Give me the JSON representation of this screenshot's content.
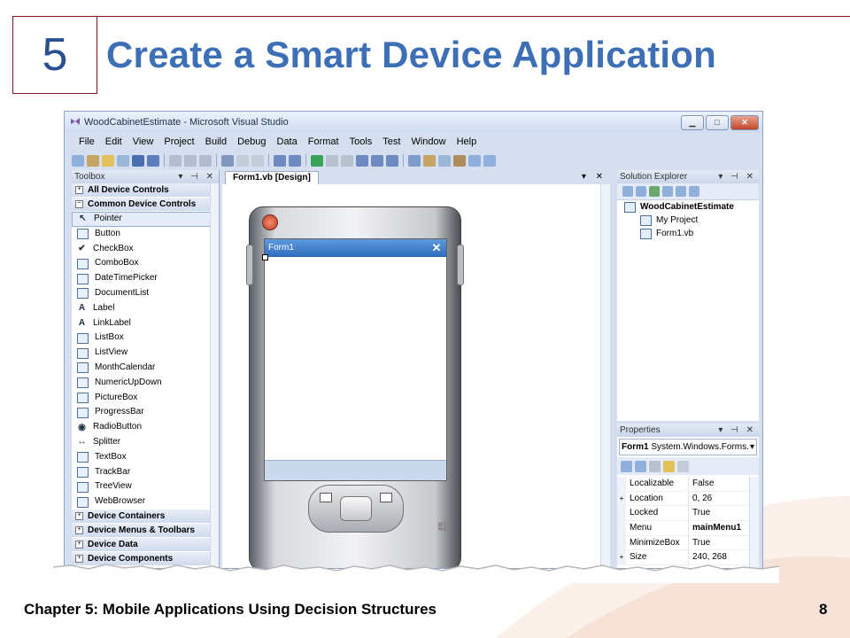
{
  "slide": {
    "chapter_number": "5",
    "title": "Create a Smart Device Application",
    "footer": "Chapter 5: Mobile Applications Using Decision Structures",
    "page_number": "8"
  },
  "colors": {
    "title": "#3d6fb6",
    "accent_line": "#7a1a1a",
    "form_titlebar": "#3f7fcf"
  },
  "window": {
    "title": "WoodCabinetEstimate - Microsoft Visual Studio",
    "menu": [
      "File",
      "Edit",
      "View",
      "Project",
      "Build",
      "Debug",
      "Data",
      "Format",
      "Tools",
      "Test",
      "Window",
      "Help"
    ]
  },
  "toolbox": {
    "title": "Toolbox",
    "category_all": "All Device Controls",
    "category_common": "Common Device Controls",
    "items": [
      {
        "label": "Pointer",
        "icon": "pointer-icon"
      },
      {
        "label": "Button",
        "icon": "button-icon"
      },
      {
        "label": "CheckBox",
        "icon": "checkbox-icon"
      },
      {
        "label": "ComboBox",
        "icon": "combobox-icon"
      },
      {
        "label": "DateTimePicker",
        "icon": "datetimepicker-icon"
      },
      {
        "label": "DocumentList",
        "icon": "documentlist-icon"
      },
      {
        "label": "Label",
        "icon": "label-icon"
      },
      {
        "label": "LinkLabel",
        "icon": "linklabel-icon"
      },
      {
        "label": "ListBox",
        "icon": "listbox-icon"
      },
      {
        "label": "ListView",
        "icon": "listview-icon"
      },
      {
        "label": "MonthCalendar",
        "icon": "monthcalendar-icon"
      },
      {
        "label": "NumericUpDown",
        "icon": "numericupdown-icon"
      },
      {
        "label": "PictureBox",
        "icon": "picturebox-icon"
      },
      {
        "label": "ProgressBar",
        "icon": "progressbar-icon"
      },
      {
        "label": "RadioButton",
        "icon": "radiobutton-icon"
      },
      {
        "label": "Splitter",
        "icon": "splitter-icon"
      },
      {
        "label": "TextBox",
        "icon": "textbox-icon"
      },
      {
        "label": "TrackBar",
        "icon": "trackbar-icon"
      },
      {
        "label": "TreeView",
        "icon": "treeview-icon"
      },
      {
        "label": "WebBrowser",
        "icon": "webbrowser-icon"
      }
    ],
    "bottom_categories": [
      "Device Containers",
      "Device Menus & Toolbars",
      "Device Data",
      "Device Components"
    ]
  },
  "designer": {
    "tab": "Form1.vb [Design]",
    "form_title": "Form1",
    "form_close": "✕"
  },
  "solution_explorer": {
    "title": "Solution Explorer",
    "root": "WoodCabinetEstimate",
    "children": [
      "My Project",
      "Form1.vb"
    ]
  },
  "properties": {
    "title": "Properties",
    "object": "Form1",
    "object_type": "System.Windows.Forms.",
    "rows": [
      {
        "expand": "",
        "name": "Localizable",
        "value": "False",
        "bold": false
      },
      {
        "expand": "+",
        "name": "Location",
        "value": "0, 26",
        "bold": false
      },
      {
        "expand": "",
        "name": "Locked",
        "value": "True",
        "bold": false
      },
      {
        "expand": "",
        "name": "Menu",
        "value": "mainMenu1",
        "bold": true
      },
      {
        "expand": "",
        "name": "MinimizeBox",
        "value": "True",
        "bold": false
      },
      {
        "expand": "+",
        "name": "Size",
        "value": "240, 268",
        "bold": false
      }
    ]
  }
}
